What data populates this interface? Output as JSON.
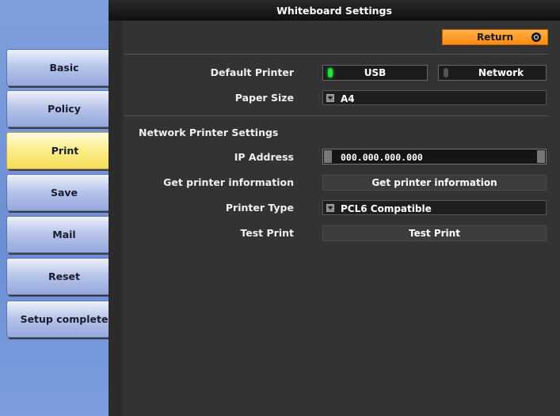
{
  "window": {
    "title": "Whiteboard Settings"
  },
  "sidebar": {
    "items": [
      {
        "label": "Basic",
        "active": false
      },
      {
        "label": "Policy",
        "active": false
      },
      {
        "label": "Print",
        "active": true
      },
      {
        "label": "Save",
        "active": false
      },
      {
        "label": "Mail",
        "active": false
      },
      {
        "label": "Reset",
        "active": false
      },
      {
        "label": "Setup complete",
        "active": false
      }
    ]
  },
  "header": {
    "return_label": "Return",
    "return_icon": "return-icon"
  },
  "settings": {
    "default_printer": {
      "label": "Default Printer",
      "options": [
        {
          "label": "USB",
          "selected": true
        },
        {
          "label": "Network",
          "selected": false
        }
      ]
    },
    "paper_size": {
      "label": "Paper Size",
      "value": "A4"
    },
    "network_section_label": "Network Printer Settings",
    "ip_address": {
      "label": "IP Address",
      "value": "000.000.000.000"
    },
    "get_printer_info": {
      "label": "Get printer information",
      "button_label": "Get printer information"
    },
    "printer_type": {
      "label": "Printer Type",
      "value": "PCL6 Compatible"
    },
    "test_print": {
      "label": "Test Print",
      "button_label": "Test Print"
    }
  },
  "colors": {
    "accent_return": "#ff8a10",
    "active_tab": "#fcee8c",
    "panel_bg": "#333333",
    "led_on": "#22e040"
  }
}
